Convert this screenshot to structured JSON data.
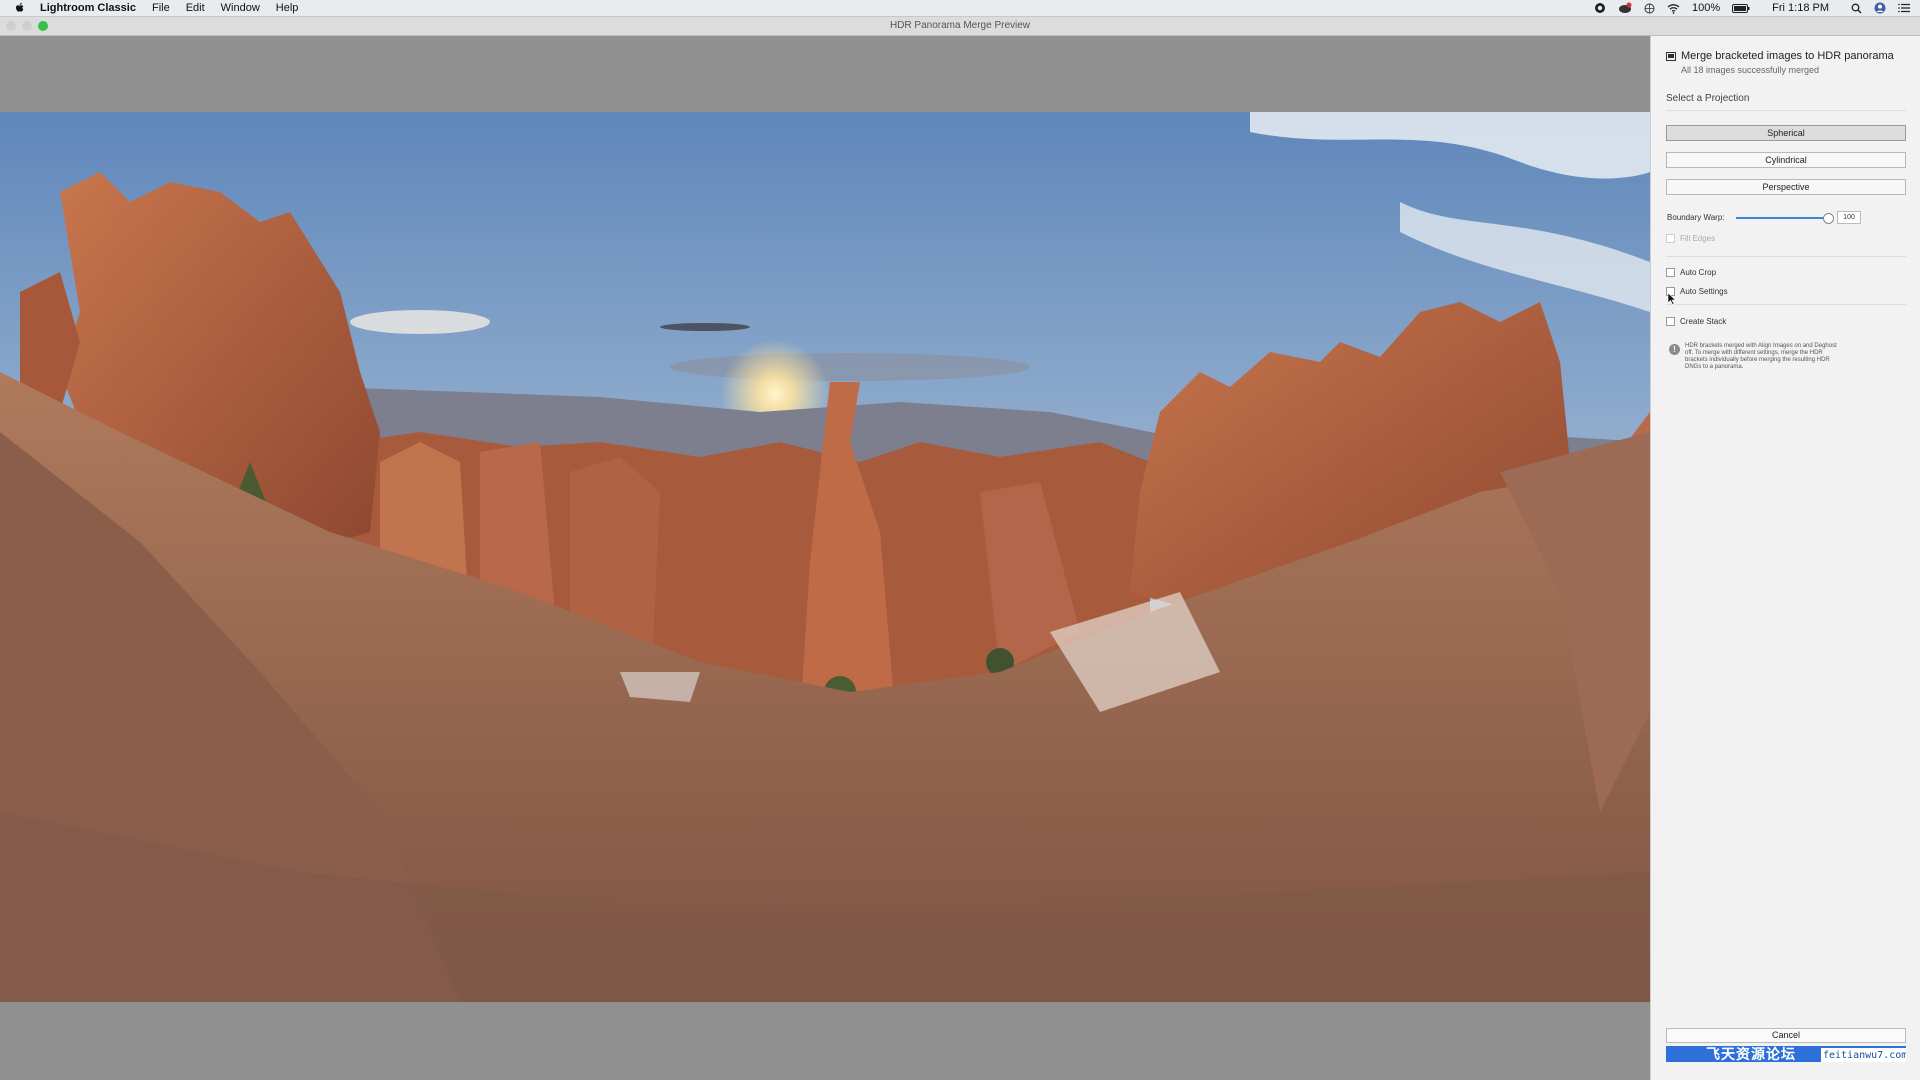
{
  "menubar": {
    "app_name": "Lightroom Classic",
    "menus": [
      "File",
      "Edit",
      "Window",
      "Help"
    ],
    "battery": "100%",
    "clock": "Fri 1:18 PM"
  },
  "window": {
    "title": "HDR Panorama Merge Preview"
  },
  "panel": {
    "header": "Merge bracketed images to HDR panorama",
    "status": "All 18 images successfully merged",
    "projection_label": "Select a Projection",
    "projections": [
      "Spherical",
      "Cylindrical",
      "Perspective"
    ],
    "selected_projection": "Spherical",
    "boundary_warp_label": "Boundary Warp:",
    "boundary_warp_value": "100",
    "boundary_warp_fraction": 1.0,
    "fill_edges_label": "Fill Edges",
    "auto_crop_label": "Auto Crop",
    "auto_settings_label": "Auto Settings",
    "create_stack_label": "Create Stack",
    "note": "HDR brackets merged with Align Images on and Deghost off. To merge with different settings, merge the HDR brackets individually before merging the resulting HDR DNGs to a panorama.",
    "cancel_label": "Cancel",
    "watermark_cn": "飞天资源论坛",
    "watermark_en": "feitianwu7.com"
  },
  "colors": {
    "accent": "#2d70d9",
    "sky_top": "#6f93c0",
    "rock": "#b35e3c",
    "ground": "#9a6a55"
  }
}
